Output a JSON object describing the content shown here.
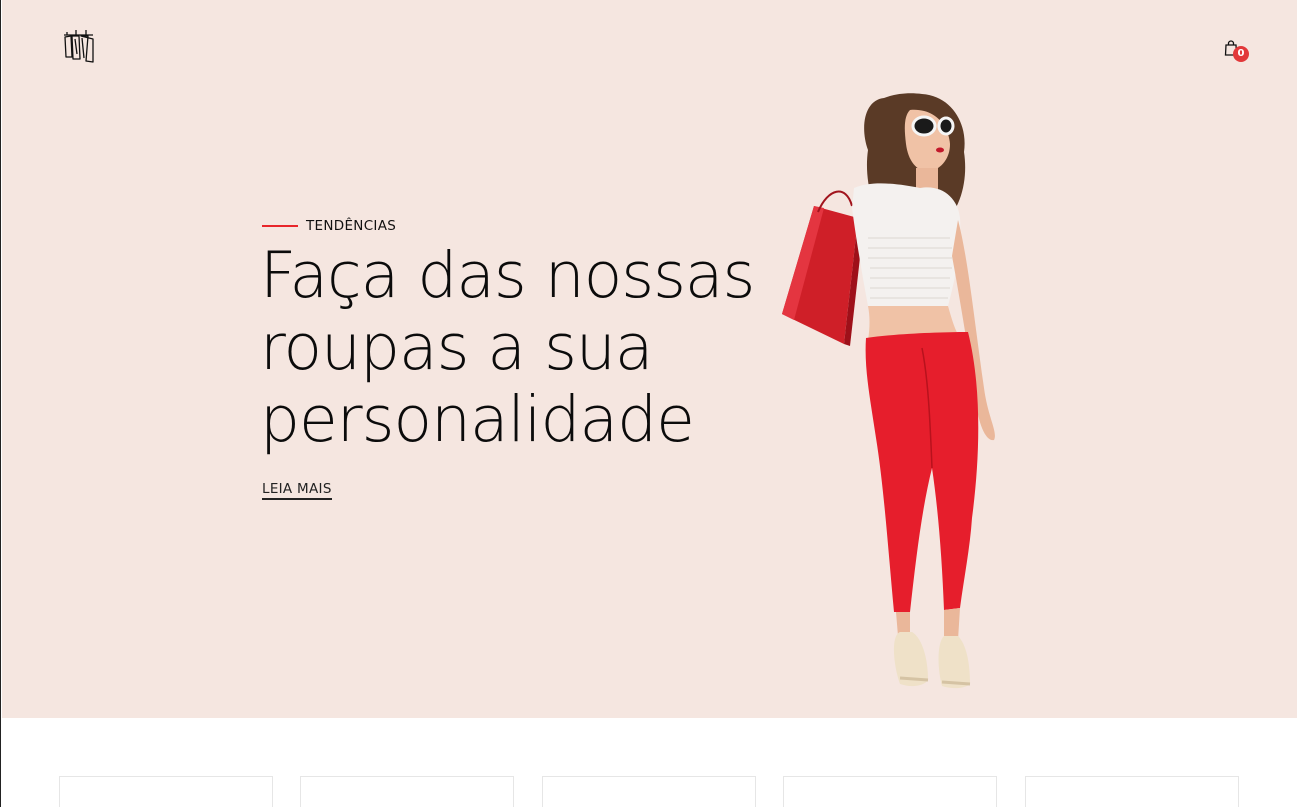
{
  "header": {
    "logo_icon": "clothing-rack-icon",
    "cart_icon": "shopping-bag-icon",
    "cart_count": "0"
  },
  "hero": {
    "eyebrow": "TENDÊNCIAS",
    "headline": "Faça das nossas roupas a sua personalidade",
    "cta_label": "LEIA MAIS",
    "background_color": "#f5e6e0",
    "accent_color": "#e8262b"
  }
}
